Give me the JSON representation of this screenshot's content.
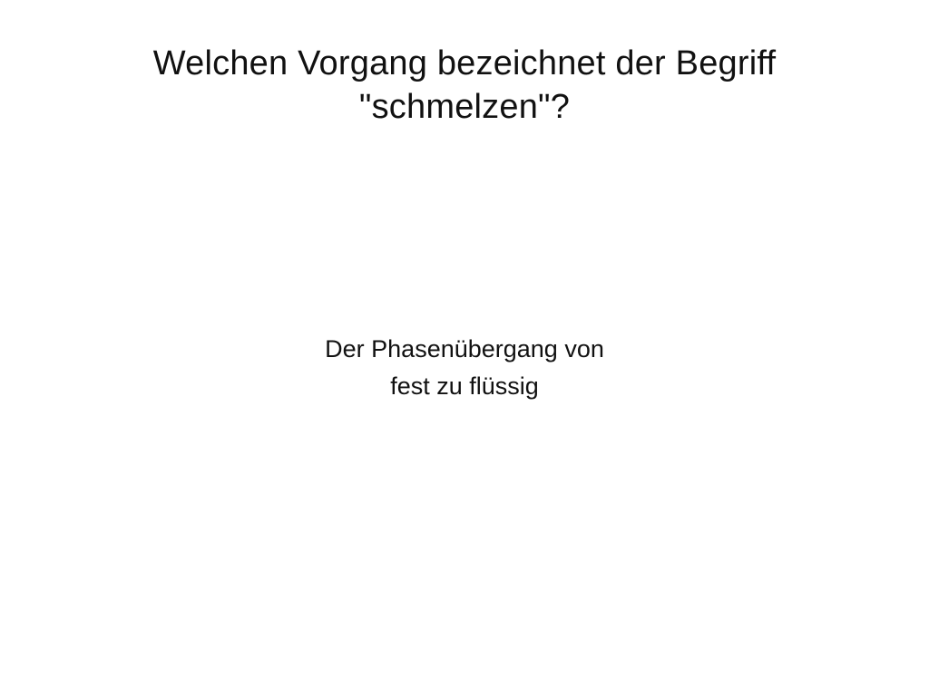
{
  "card": {
    "question_lines": [
      "Welchen Vorgang bezeichnet der Begriff",
      "\"schmelzen\"?"
    ],
    "answer_lines": [
      "Der Phasenübergang von",
      "fest zu flüssig"
    ]
  }
}
